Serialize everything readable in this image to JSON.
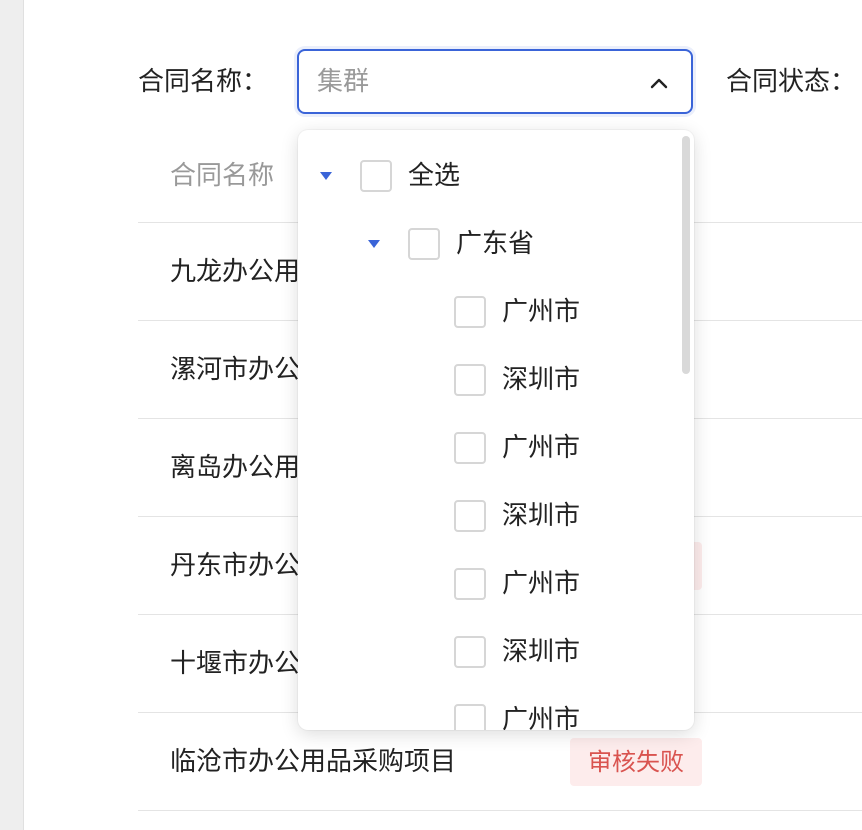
{
  "filters": {
    "name_label": "合同名称：",
    "status_label": "合同状态：",
    "name_select_value": "集群",
    "chevron_icon": "chevron-up-icon"
  },
  "table": {
    "header_name": "合同名称",
    "rows": [
      {
        "name": "九龙办公用"
      },
      {
        "name": "漯河市办公"
      },
      {
        "name": "离岛办公用"
      },
      {
        "name": "丹东市办公"
      },
      {
        "name": "十堰市办公"
      },
      {
        "name": "临沧市办公用品采购项目",
        "status": "审核失败"
      }
    ]
  },
  "dropdown": {
    "options": [
      {
        "label": "全选",
        "level": 0,
        "expanded": true
      },
      {
        "label": "广东省",
        "level": 1,
        "expanded": true
      },
      {
        "label": "广州市",
        "level": 2
      },
      {
        "label": "深圳市",
        "level": 2
      },
      {
        "label": "广州市",
        "level": 2
      },
      {
        "label": "深圳市",
        "level": 2
      },
      {
        "label": "广州市",
        "level": 2
      },
      {
        "label": "深圳市",
        "level": 2
      },
      {
        "label": "广州市",
        "level": 2
      }
    ]
  },
  "colors": {
    "accent": "#3a64d8",
    "badge_bg": "#fdecec",
    "badge_text": "#d9534f"
  }
}
